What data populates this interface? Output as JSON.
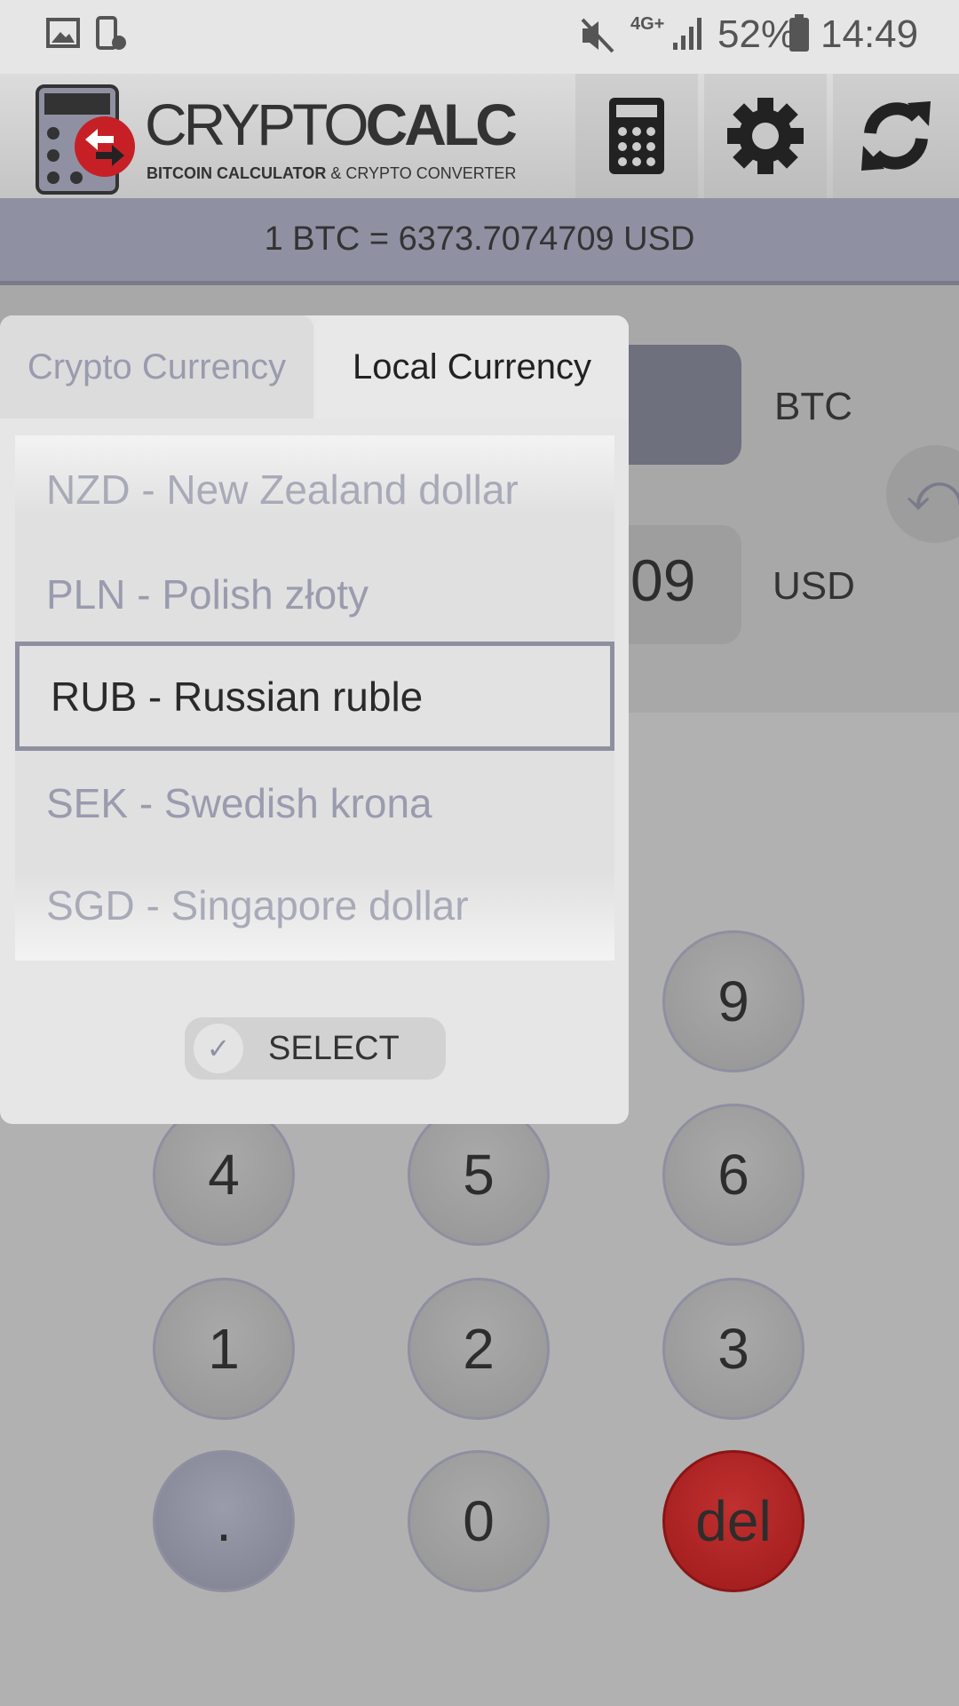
{
  "status_bar": {
    "battery": "52%",
    "time": "14:49",
    "network": "4G+"
  },
  "header": {
    "logo_title_light": "CRYPTO",
    "logo_title_bold": "CALC",
    "logo_subtitle_bold": "BITCOIN CALCULATOR",
    "logo_subtitle_rest": "& CRYPTO CONVERTER",
    "icons": [
      "calculator-icon",
      "gear-icon",
      "refresh-icon"
    ]
  },
  "rate": {
    "text": "1 BTC = 6373.7074709 USD"
  },
  "converter": {
    "crypto_code": "BTC",
    "local_code": "USD",
    "local_value_visible": "09"
  },
  "keypad": {
    "keys": [
      "9",
      "4",
      "5",
      "6",
      "1",
      "2",
      "3",
      ".",
      "0",
      "del"
    ]
  },
  "dialog": {
    "tabs": [
      {
        "label": "Crypto Currency",
        "active": false
      },
      {
        "label": "Local Currency",
        "active": true
      }
    ],
    "items": [
      "NZD - New Zealand dollar",
      "PLN - Polish złoty",
      "RUB - Russian ruble",
      "SEK - Swedish krona",
      "SGD - Singapore dollar"
    ],
    "selected": "RUB - Russian ruble",
    "select_label": "SELECT"
  },
  "colors": {
    "accent": "#8f91a2",
    "del": "#b52020"
  }
}
